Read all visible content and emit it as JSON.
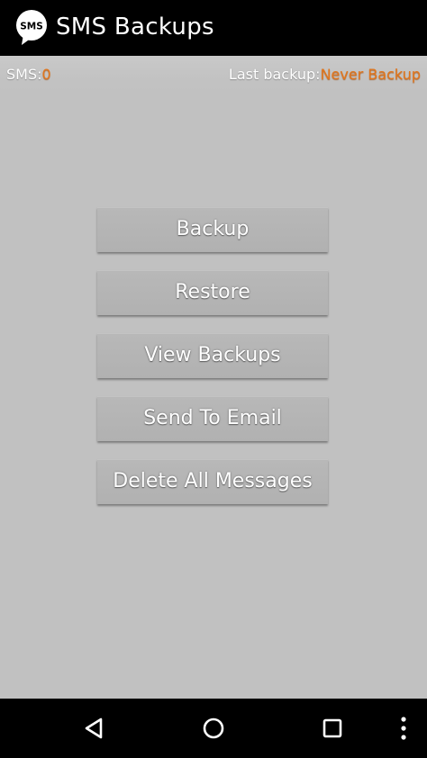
{
  "app": {
    "title": "SMS Backups",
    "icon": "sms-bubble-icon",
    "icon_text": "SMS"
  },
  "status": {
    "sms_label": "SMS:",
    "sms_count": "0",
    "last_backup_label": "Last backup:",
    "last_backup_value": "Never Backup"
  },
  "buttons": {
    "backup": "Backup",
    "restore": "Restore",
    "view_backups": "View Backups",
    "send_to_email": "Send To Email",
    "delete_all": "Delete All Messages"
  },
  "navbar": {
    "icons": [
      "back-icon",
      "home-icon",
      "recents-icon",
      "overflow-menu-icon"
    ]
  },
  "colors": {
    "accent": "#e0751c",
    "background": "#c1c1c1",
    "titlebar": "#000000",
    "button": "#b5b5b5"
  }
}
